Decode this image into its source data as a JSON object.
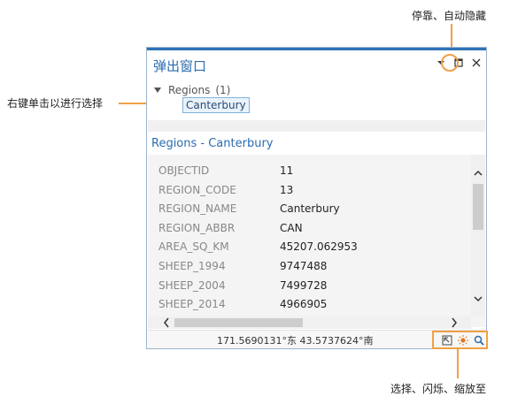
{
  "callouts": {
    "dock": "停靠、自动隐藏",
    "right_click": "右键单击以进行选择",
    "tools": "选择、闪烁、缩放至"
  },
  "window": {
    "title": "弹出窗口",
    "tree": {
      "layer": "Regions",
      "count": "(1)",
      "feature": "Canterbury"
    },
    "section_title": "Regions - Canterbury",
    "attributes": [
      {
        "key": "OBJECTID",
        "value": "11"
      },
      {
        "key": "REGION_CODE",
        "value": "13"
      },
      {
        "key": "REGION_NAME",
        "value": "Canterbury"
      },
      {
        "key": "REGION_ABBR",
        "value": "CAN"
      },
      {
        "key": "AREA_SQ_KM",
        "value": "45207.062953"
      },
      {
        "key": "SHEEP_1994",
        "value": "9747488"
      },
      {
        "key": "SHEEP_2004",
        "value": "7499728"
      },
      {
        "key": "SHEEP_2014",
        "value": "4966905"
      }
    ],
    "status": {
      "coordinates": "171.5690131°东  43.5737624°南"
    }
  },
  "icons": {
    "pin": "chevron-down-icon",
    "maximize": "maximize-icon",
    "close": "close-icon",
    "select": "select-icon",
    "flash": "flash-icon",
    "zoom": "zoom-icon"
  },
  "colors": {
    "accent": "#2b6cb0",
    "callout": "#f0a046"
  }
}
